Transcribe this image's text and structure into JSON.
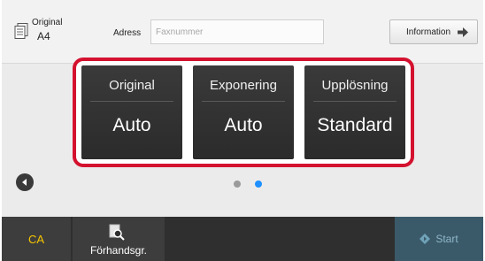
{
  "header": {
    "original_label": "Original",
    "original_size": "A4",
    "address_label": "Adress",
    "fax_placeholder": "Faxnummer",
    "fax_value": "",
    "info_label": "Information"
  },
  "settings": [
    {
      "title": "Original",
      "value": "Auto"
    },
    {
      "title": "Exponering",
      "value": "Auto"
    },
    {
      "title": "Upplösning",
      "value": "Standard"
    }
  ],
  "pager": {
    "total_pages": 2,
    "current_page": 2
  },
  "footer": {
    "ca_label": "CA",
    "preview_label": "Förhandsgr.",
    "start_label": "Start"
  },
  "colors": {
    "highlight_frame": "#d4122f",
    "ca_text": "#f7c600",
    "page_dot_active": "#1e90ff",
    "page_dot_inactive": "#9a9a9a",
    "start_disabled_bg": "#3b5a69"
  }
}
